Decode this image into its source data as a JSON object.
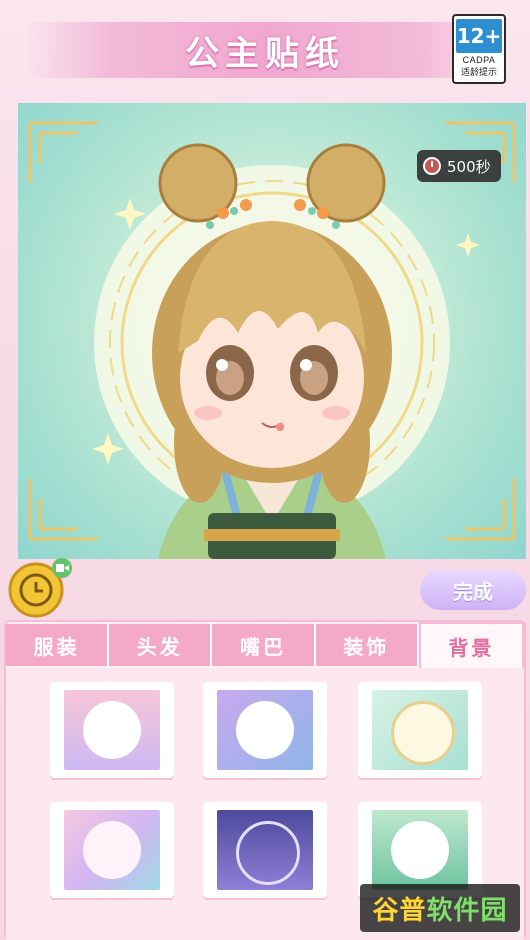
{
  "header": {
    "title": "公主贴纸"
  },
  "age_rating": {
    "number": "12+",
    "org": "CADPA",
    "caption": "适龄提示"
  },
  "timer": {
    "label": "500秒"
  },
  "actions": {
    "done_label": "完成"
  },
  "tabs": [
    {
      "label": "服装",
      "active": false
    },
    {
      "label": "头发",
      "active": false
    },
    {
      "label": "嘴巴",
      "active": false
    },
    {
      "label": "装饰",
      "active": false
    },
    {
      "label": "背景",
      "active": true
    }
  ],
  "backgrounds": [
    {
      "name": "bg-pink-curtain"
    },
    {
      "name": "bg-purple-blue"
    },
    {
      "name": "bg-mint-lace"
    },
    {
      "name": "bg-pink-scallop"
    },
    {
      "name": "bg-magic-circle"
    },
    {
      "name": "bg-green-stage"
    }
  ],
  "watermark": {
    "text_a": "谷普",
    "text_b": "软件园"
  },
  "icons": {
    "coin": "coin-clock-icon",
    "video": "video-icon",
    "timer": "clock-icon"
  },
  "colors": {
    "accent_pink": "#f4a9c9",
    "done_purple": "#cdb3f6",
    "stage_teal": "#8fd6cf"
  }
}
